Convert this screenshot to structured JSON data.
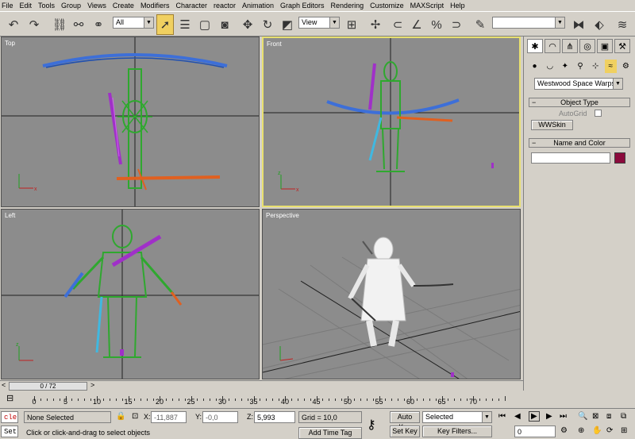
{
  "menu": [
    "File",
    "Edit",
    "Tools",
    "Group",
    "Views",
    "Create",
    "Modifiers",
    "Character",
    "reactor",
    "Animation",
    "Graph Editors",
    "Rendering",
    "Customize",
    "MAXScript",
    "Help"
  ],
  "toolbar": {
    "selection_filter": "All",
    "reference_coord": "View",
    "named_selection": ""
  },
  "viewports": {
    "top": "Top",
    "front": "Front",
    "left": "Left",
    "perspective": "Perspective",
    "axis_x": "x",
    "axis_z": "z"
  },
  "command_panel": {
    "category": "Westwood Space Warps",
    "object_type_title": "Object Type",
    "autogrid_label": "AutoGrid",
    "wwskin_button": "WWSkin",
    "name_color_title": "Name and Color",
    "name_value": "",
    "object_color": "#8b0a3c"
  },
  "timeline": {
    "frame_display": "0 / 72",
    "prev": "<",
    "next": ">",
    "ticks": [
      0,
      5,
      10,
      15,
      20,
      25,
      30,
      35,
      40,
      45,
      50,
      55,
      60,
      65,
      70
    ]
  },
  "status": {
    "selection": "None Selected",
    "x_label": "X:",
    "x_value": "-11,887",
    "y_label": "Y:",
    "y_value": "-0,0",
    "z_label": "Z:",
    "z_value": "5,993",
    "grid": "Grid = 10,0",
    "prompt": "Click or click-and-drag to select objects",
    "add_time_tag": "Add Time Tag",
    "auto_key": "Auto Key",
    "set_key": "Set Key",
    "key_mode": "Selected",
    "key_filters": "Key Filters...",
    "current_frame": "0",
    "listener_top": "cle",
    "listener_bottom": "Set"
  },
  "colors": {
    "bg": "#d4d0c8",
    "viewport": "#8c8c8c",
    "active_border": "#e8e070",
    "blue": "#3d6fd8",
    "green": "#2fa82f",
    "purple": "#a030c8",
    "orange": "#e06020",
    "cyan": "#40b8e0"
  }
}
